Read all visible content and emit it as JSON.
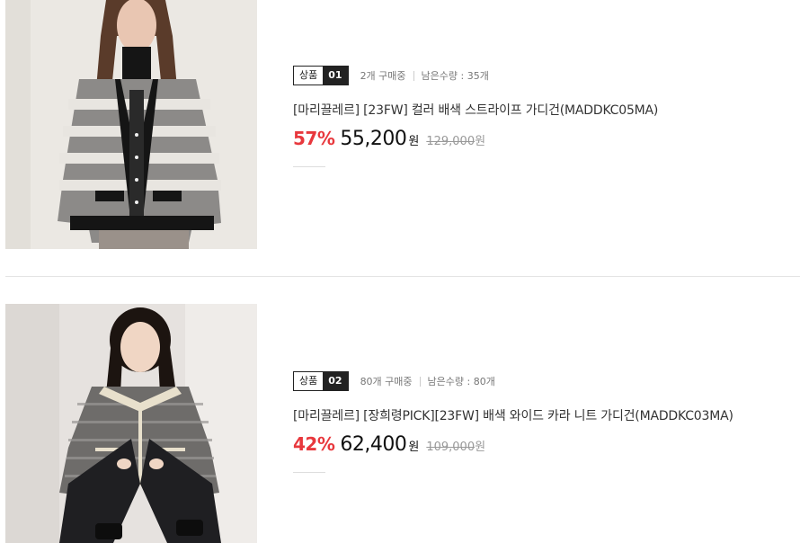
{
  "products": [
    {
      "badge_label": "상품",
      "badge_num": "01",
      "purchasing": "2개 구매중",
      "remaining": "남은수량 : 35개",
      "title": "[마리끌레르] [23FW] 컬러 배색 스트라이프 가디건(MADDKC05MA)",
      "discount": "57%",
      "price": "55,200",
      "currency": "원",
      "original_price": "129,000",
      "image_icon": "model-striped-cardigan-photo"
    },
    {
      "badge_label": "상품",
      "badge_num": "02",
      "purchasing": "80개 구매중",
      "remaining": "남은수량 : 80개",
      "title": "[마리끌레르] [장희령PICK][23FW] 배색 와이드 카라 니트 가디건(MADDKC03MA)",
      "discount": "42%",
      "price": "62,400",
      "currency": "원",
      "original_price": "109,000",
      "image_icon": "model-tweed-cardigan-photo"
    }
  ],
  "colors": {
    "discount": "#e8383d",
    "badge_dark": "#222222"
  }
}
